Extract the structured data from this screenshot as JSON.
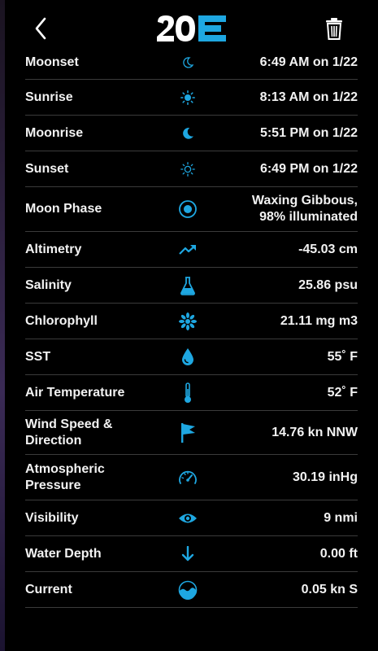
{
  "app": {
    "logo_text": "20E"
  },
  "colors": {
    "accent": "#1ea7e1",
    "background": "#000000",
    "divider": "#3b3b3b"
  },
  "rows": [
    {
      "label": "Moonset",
      "icon": "moon-icon",
      "value": "6:49 AM on 1/22"
    },
    {
      "label": "Sunrise",
      "icon": "sun-icon",
      "value": "8:13 AM on 1/22"
    },
    {
      "label": "Moonrise",
      "icon": "moon-icon",
      "value": "5:51 PM on 1/22"
    },
    {
      "label": "Sunset",
      "icon": "sun-outline-icon",
      "value": "6:49 PM on 1/22"
    },
    {
      "label": "Moon Phase",
      "icon": "moon-phase-icon",
      "value_line1": "Waxing Gibbous,",
      "value_line2": "98% illuminated"
    },
    {
      "label": "Altimetry",
      "icon": "trending-up-icon",
      "value": "-45.03 cm"
    },
    {
      "label": "Salinity",
      "icon": "flask-icon",
      "value": "25.86 psu"
    },
    {
      "label": "Chlorophyll",
      "icon": "chlorophyll-icon",
      "value": "21.11 mg m3"
    },
    {
      "label": "SST",
      "icon": "water-drop-icon",
      "value": "55˚ F"
    },
    {
      "label": "Air Temperature",
      "icon": "thermometer-icon",
      "value": "52˚ F"
    },
    {
      "label_line1": "Wind Speed &",
      "label_line2": "Direction",
      "icon": "flag-icon",
      "value": "14.76 kn NNW"
    },
    {
      "label_line1": "Atmospheric",
      "label_line2": "Pressure",
      "icon": "gauge-icon",
      "value": "30.19 inHg"
    },
    {
      "label": "Visibility",
      "icon": "eye-icon",
      "value": "9 nmi"
    },
    {
      "label": "Water Depth",
      "icon": "arrow-down-icon",
      "value": "0.00 ft"
    },
    {
      "label": "Current",
      "icon": "current-icon",
      "value": "0.05 kn S"
    }
  ]
}
